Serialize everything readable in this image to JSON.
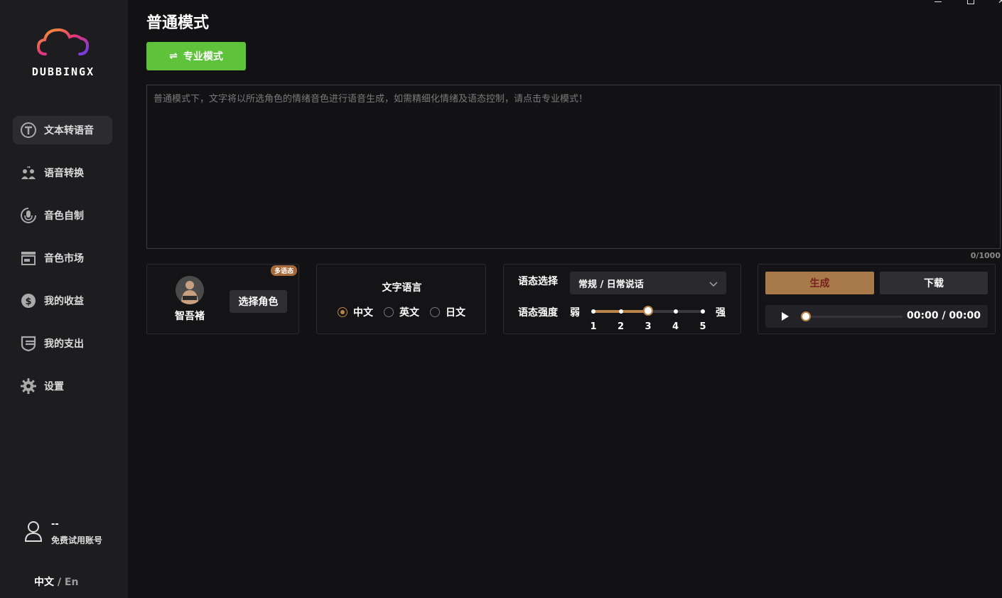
{
  "brand": {
    "name": "DUBBINGX"
  },
  "sidebar": {
    "items": [
      {
        "label": "文本转语音",
        "icon": "text-to-speech-icon",
        "active": true
      },
      {
        "label": "语音转换",
        "icon": "voice-convert-icon",
        "active": false
      },
      {
        "label": "音色自制",
        "icon": "custom-voice-icon",
        "active": false
      },
      {
        "label": "音色市场",
        "icon": "voice-market-icon",
        "active": false
      },
      {
        "label": "我的收益",
        "icon": "earnings-icon",
        "active": false
      },
      {
        "label": "我的支出",
        "icon": "expenses-icon",
        "active": false
      },
      {
        "label": "设置",
        "icon": "gear-icon",
        "active": false
      }
    ],
    "user": {
      "name": "--",
      "account_type": "免费试用账号",
      "icon": "user-icon"
    },
    "language": {
      "current": "中文",
      "separator": "/",
      "alternate": "En"
    }
  },
  "main": {
    "title": "普通模式",
    "mode_button": "专业模式",
    "text_input": {
      "value": "",
      "placeholder": "普通模式下，文字将以所选角色的情绪音色进行语音生成，如需精细化情绪及语态控制，请点击专业模式！",
      "count": "0/1000"
    },
    "character": {
      "badge": "多语态",
      "name": "智吾褚",
      "select_button": "选择角色"
    },
    "text_language": {
      "title": "文字语言",
      "options": [
        "中文",
        "英文",
        "日文"
      ],
      "selected": "中文"
    },
    "style": {
      "select_label": "语态选择",
      "selected_value": "常规 / 日常说话",
      "intensity_label": "语态强度",
      "weak": "弱",
      "strong": "强",
      "levels": [
        "1",
        "2",
        "3",
        "4",
        "5"
      ],
      "value": 3
    },
    "generate": {
      "generate_button": "生成",
      "download_button": "下载",
      "time": "00:00 / 00:00",
      "progress": 0
    }
  },
  "colors": {
    "accent_green": "#5ec23a",
    "accent_bronze": "#b8844a",
    "generate_bg": "#a87a4a",
    "sidebar_bg": "#1d1d20",
    "page_bg": "#121214"
  }
}
